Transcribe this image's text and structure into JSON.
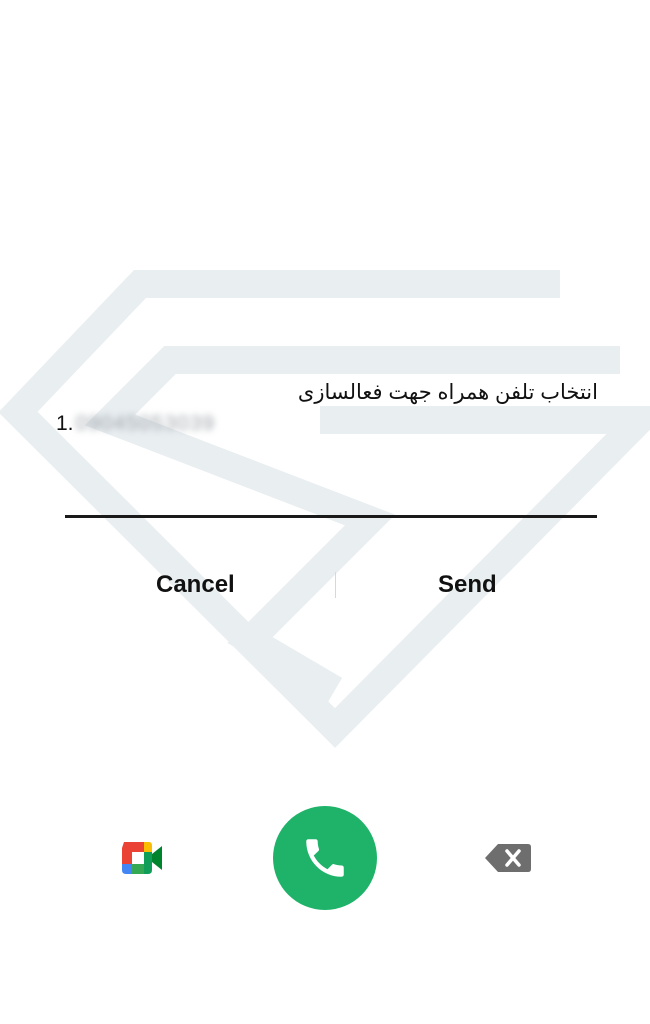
{
  "dialog": {
    "title": "انتخاب تلفن همراه جهت فعالسازی",
    "options": [
      {
        "index": "1.",
        "number": "09045053039"
      }
    ],
    "buttons": {
      "cancel": "Cancel",
      "send": "Send"
    }
  },
  "dialer": {
    "icons": {
      "meet": "google-meet-icon",
      "call": "phone-icon",
      "backspace": "backspace-icon"
    }
  },
  "colors": {
    "call_button": "#1fb36a",
    "backspace": "#6e6e6e",
    "watermark": "#e9eef1"
  }
}
